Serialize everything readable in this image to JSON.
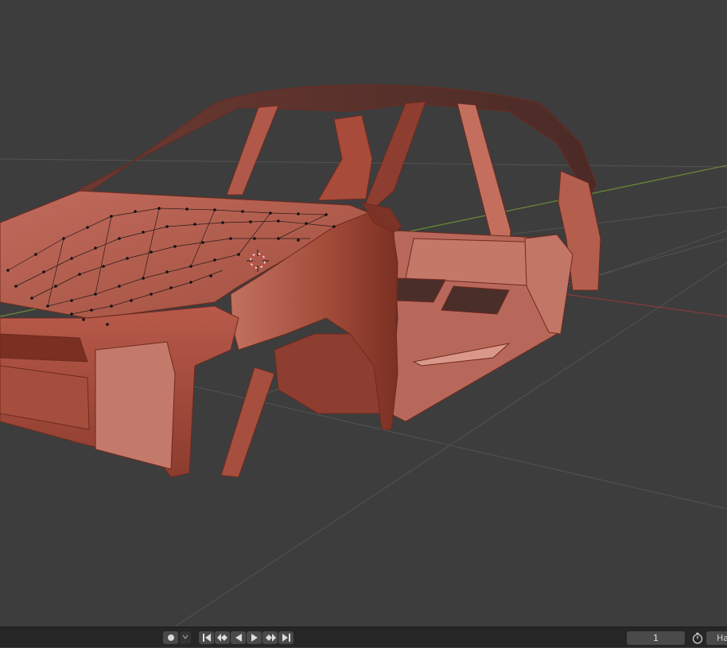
{
  "viewport": {
    "grid_color": "#555555",
    "x_axis_color": "#8a3a3a",
    "y_axis_color": "#6d8a36",
    "background": "#3d3d3d",
    "body_color": "#b0584a"
  },
  "timeline": {
    "record_icon": "record-dot-icon",
    "record_dropdown_icon": "chevron-down-icon",
    "playback_icons": [
      "jump-to-start-icon",
      "jump-to-keyframe-prev-icon",
      "play-reverse-icon",
      "play-icon",
      "jump-to-keyframe-next-icon",
      "jump-to-end-icon"
    ],
    "current_frame": "1",
    "timer_icon": "stopwatch-icon",
    "truncated_label": "Ha"
  }
}
